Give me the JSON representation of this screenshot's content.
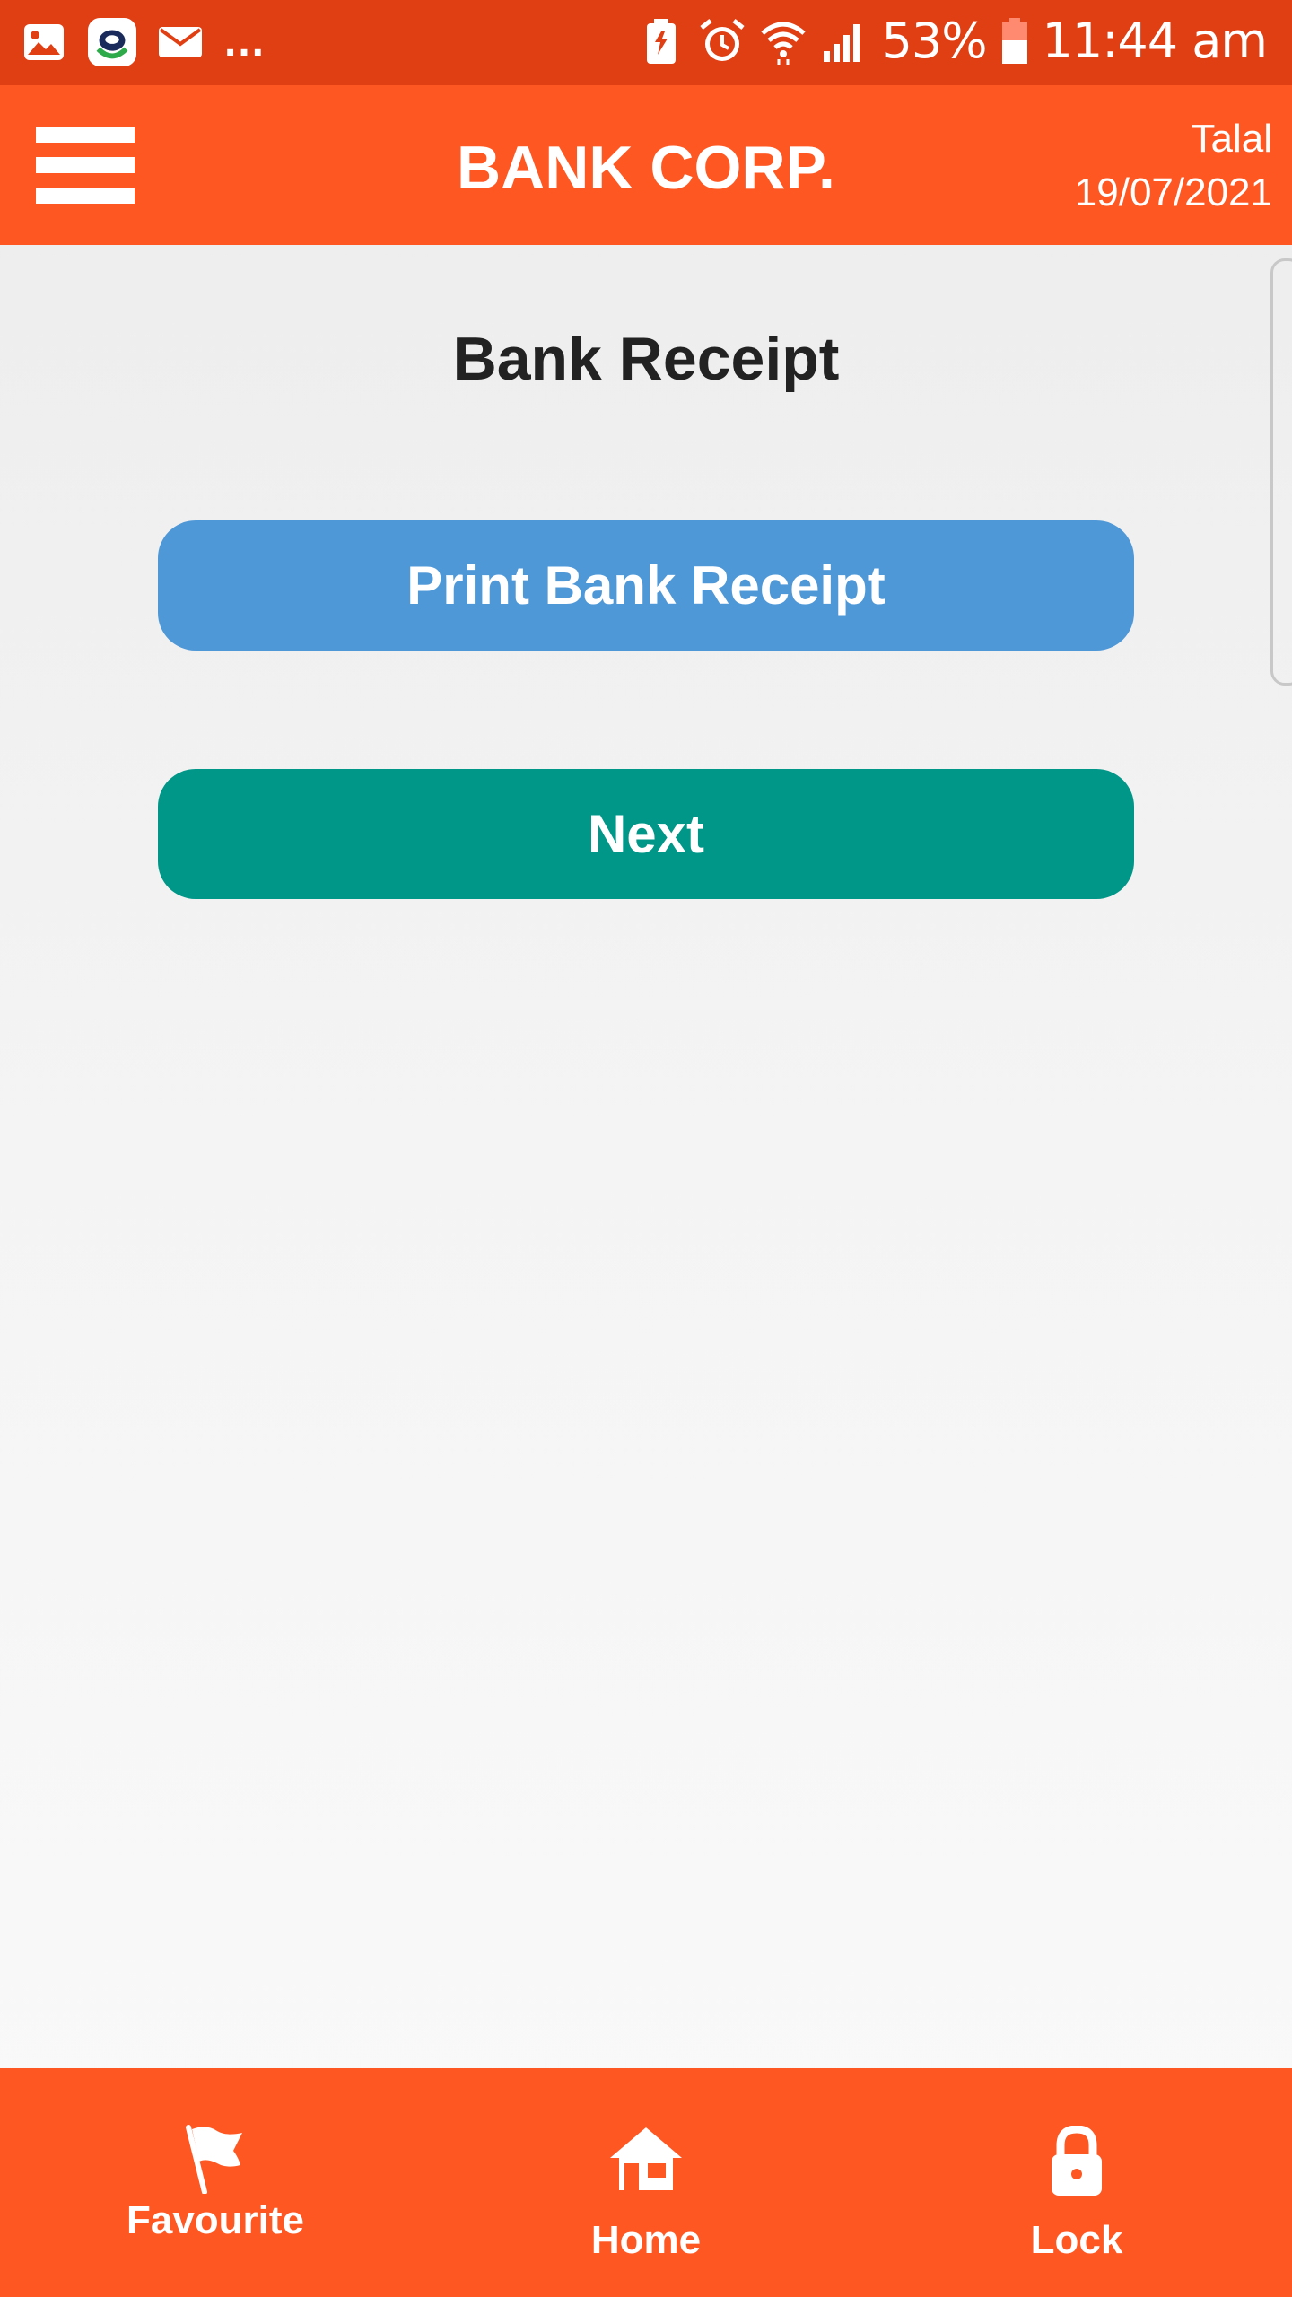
{
  "status_bar": {
    "dots": "...",
    "battery_percent": "53%",
    "time": "11:44 am",
    "icons": [
      "gallery-icon",
      "app-icon",
      "mail-icon",
      "battery-saver-icon",
      "alarm-icon",
      "wifi-icon",
      "signal-icon",
      "battery-icon"
    ]
  },
  "header": {
    "title": "BANK CORP.",
    "user_name": "Talal",
    "date": "19/07/2021",
    "menu_icon": "hamburger-menu-icon"
  },
  "main": {
    "page_title": "Bank Receipt",
    "print_button_label": "Print Bank Receipt",
    "next_button_label": "Next"
  },
  "bottom_nav": {
    "items": [
      {
        "label": "Favourite",
        "icon": "flag-icon"
      },
      {
        "label": "Home",
        "icon": "home-icon"
      },
      {
        "label": "Lock",
        "icon": "lock-icon"
      }
    ]
  },
  "colors": {
    "status_bar": "#e03f14",
    "header": "#ff5722",
    "print_button": "#4f98d8",
    "next_button": "#009688",
    "bottom_nav": "#ff5722"
  }
}
